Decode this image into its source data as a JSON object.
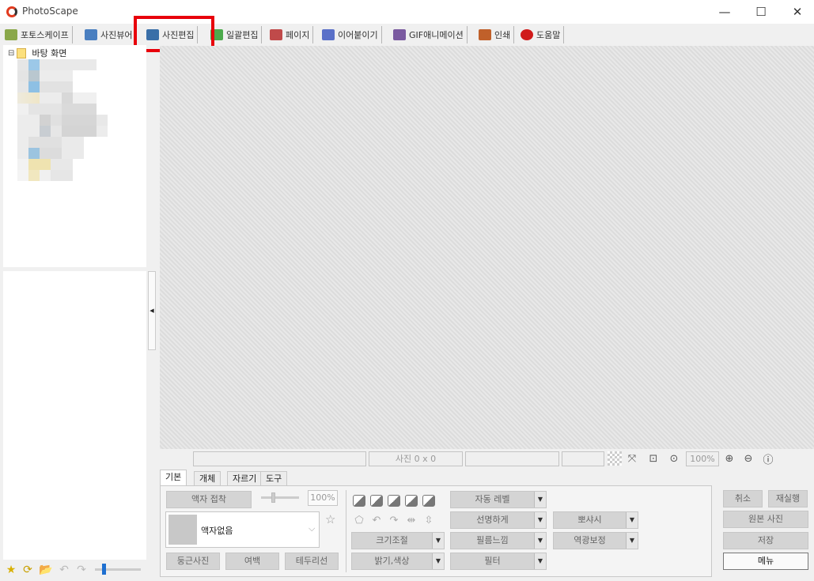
{
  "window": {
    "title": "PhotoScape",
    "minimize": "—",
    "maximize": "☐",
    "close": "✕"
  },
  "tabs": [
    {
      "label": "포토스케이프",
      "color": "#8aa84a"
    },
    {
      "label": "사진뷰어",
      "color": "#4a7fc0"
    },
    {
      "label": "사진편집",
      "color": "#3a6fa8"
    },
    {
      "label": "일괄편집",
      "color": "#4caa4c"
    },
    {
      "label": "페이지",
      "color": "#c04a4a"
    },
    {
      "label": "이어붙이기",
      "color": "#5a70c8"
    },
    {
      "label": "GIF애니메이션",
      "color": "#7a5aa0"
    },
    {
      "label": "인쇄",
      "color": "#c0602a"
    },
    {
      "label": "도움말",
      "color": "#d01a1a"
    }
  ],
  "tree": {
    "expander": "⊟",
    "folder_label": "바탕 화면"
  },
  "splitter": {
    "arrow": "◀"
  },
  "status": {
    "image_size": "사진 0 x 0",
    "zoom": "100%"
  },
  "bottom_tabs": [
    "기본",
    "개체",
    "자르기",
    "도구"
  ],
  "basic": {
    "frame_attach": "액자 접착",
    "frame_percent": "100%",
    "frame_name": "액자없음",
    "round_photo": "둥근사진",
    "margin": "여백",
    "border_line": "테두리선",
    "auto_level": "자동 레벨",
    "sharpen": "선명하게",
    "film_effect": "필름느낌",
    "filter": "필터",
    "resize": "크기조절",
    "brightness_color": "밝기,색상",
    "bloom": "뽀샤시",
    "backlight": "역광보정"
  },
  "right_buttons": {
    "undo": "취소",
    "redo": "재실행",
    "original": "원본 사진",
    "save": "저장",
    "menu": "메뉴"
  },
  "colors": {
    "highlight": "#e8000b",
    "canvas_stripe_a": "#e8e8e8",
    "canvas_stripe_b": "#dcdcdc"
  }
}
